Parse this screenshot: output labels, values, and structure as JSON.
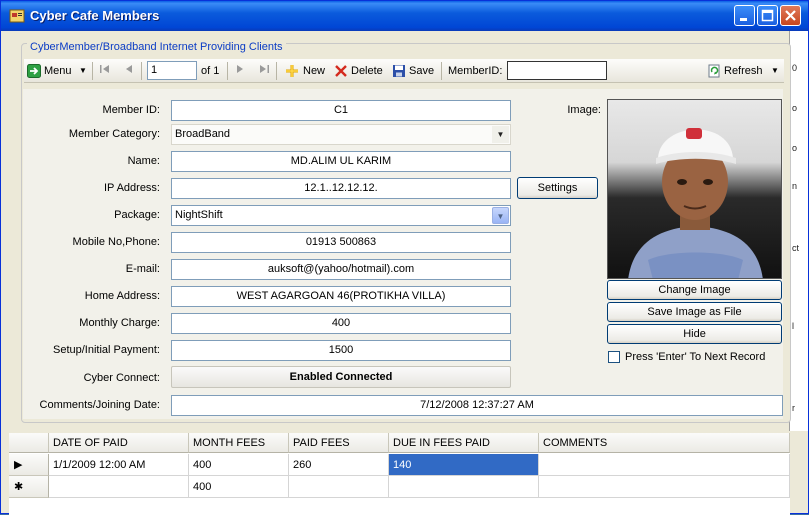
{
  "window": {
    "title": "Cyber Cafe Members"
  },
  "side_strip": {
    "texts": [
      "0",
      "o",
      "o",
      "n",
      "ct",
      "l",
      "r"
    ]
  },
  "panel": {
    "caption": "CyberMember/Broadband Internet Providing Clients"
  },
  "toolbar": {
    "menu_label": "Menu",
    "position_value": "1",
    "of_label": "of 1",
    "new_label": "New",
    "delete_label": "Delete",
    "save_label": "Save",
    "memberid_label": "MemberID:",
    "memberid_value": "",
    "refresh_label": "Refresh"
  },
  "form": {
    "member_id_label": "Member ID:",
    "member_id": "C1",
    "category_label": "Member Category:",
    "category": "BroadBand",
    "name_label": "Name:",
    "name": "MD.ALIM UL KARIM",
    "ip_label": "IP Address:",
    "ip": "12.1..12.12.12.",
    "settings_label": "Settings",
    "package_label": "Package:",
    "package": "NightShift",
    "mobile_label": "Mobile No,Phone:",
    "mobile": "01913 500863",
    "email_label": "E-mail:",
    "email": "auksoft@(yahoo/hotmail).com",
    "address_label": "Home Address:",
    "address": "WEST AGARGOAN 46(PROTIKHA VILLA)",
    "monthly_label": "Monthly Charge:",
    "monthly": "400",
    "setup_label": "Setup/Initial Payment:",
    "setup": "1500",
    "cyber_label": "Cyber Connect:",
    "cyber": "Enabled Connected",
    "comments_label": "Comments/Joining Date:",
    "comments": "7/12/2008 12:37:27 AM"
  },
  "image_panel": {
    "image_label": "Image:",
    "change_label": "Change Image",
    "save_file_label": "Save Image as File",
    "hide_label": "Hide",
    "enter_label": "Press 'Enter' To Next Record"
  },
  "grid": {
    "columns": [
      "DATE OF PAID",
      "MONTH FEES",
      "PAID FEES",
      "DUE IN FEES PAID",
      "COMMENTS"
    ],
    "rows": [
      [
        "1/1/2009 12:00 AM",
        "400",
        "260",
        "140",
        ""
      ],
      [
        "",
        "400",
        "",
        "",
        ""
      ]
    ],
    "row_markers": [
      "▶",
      "✱"
    ]
  },
  "colors": {
    "titlebar": "#0046d5",
    "caption_text": "#0b3cc5",
    "selection": "#316ac5"
  }
}
